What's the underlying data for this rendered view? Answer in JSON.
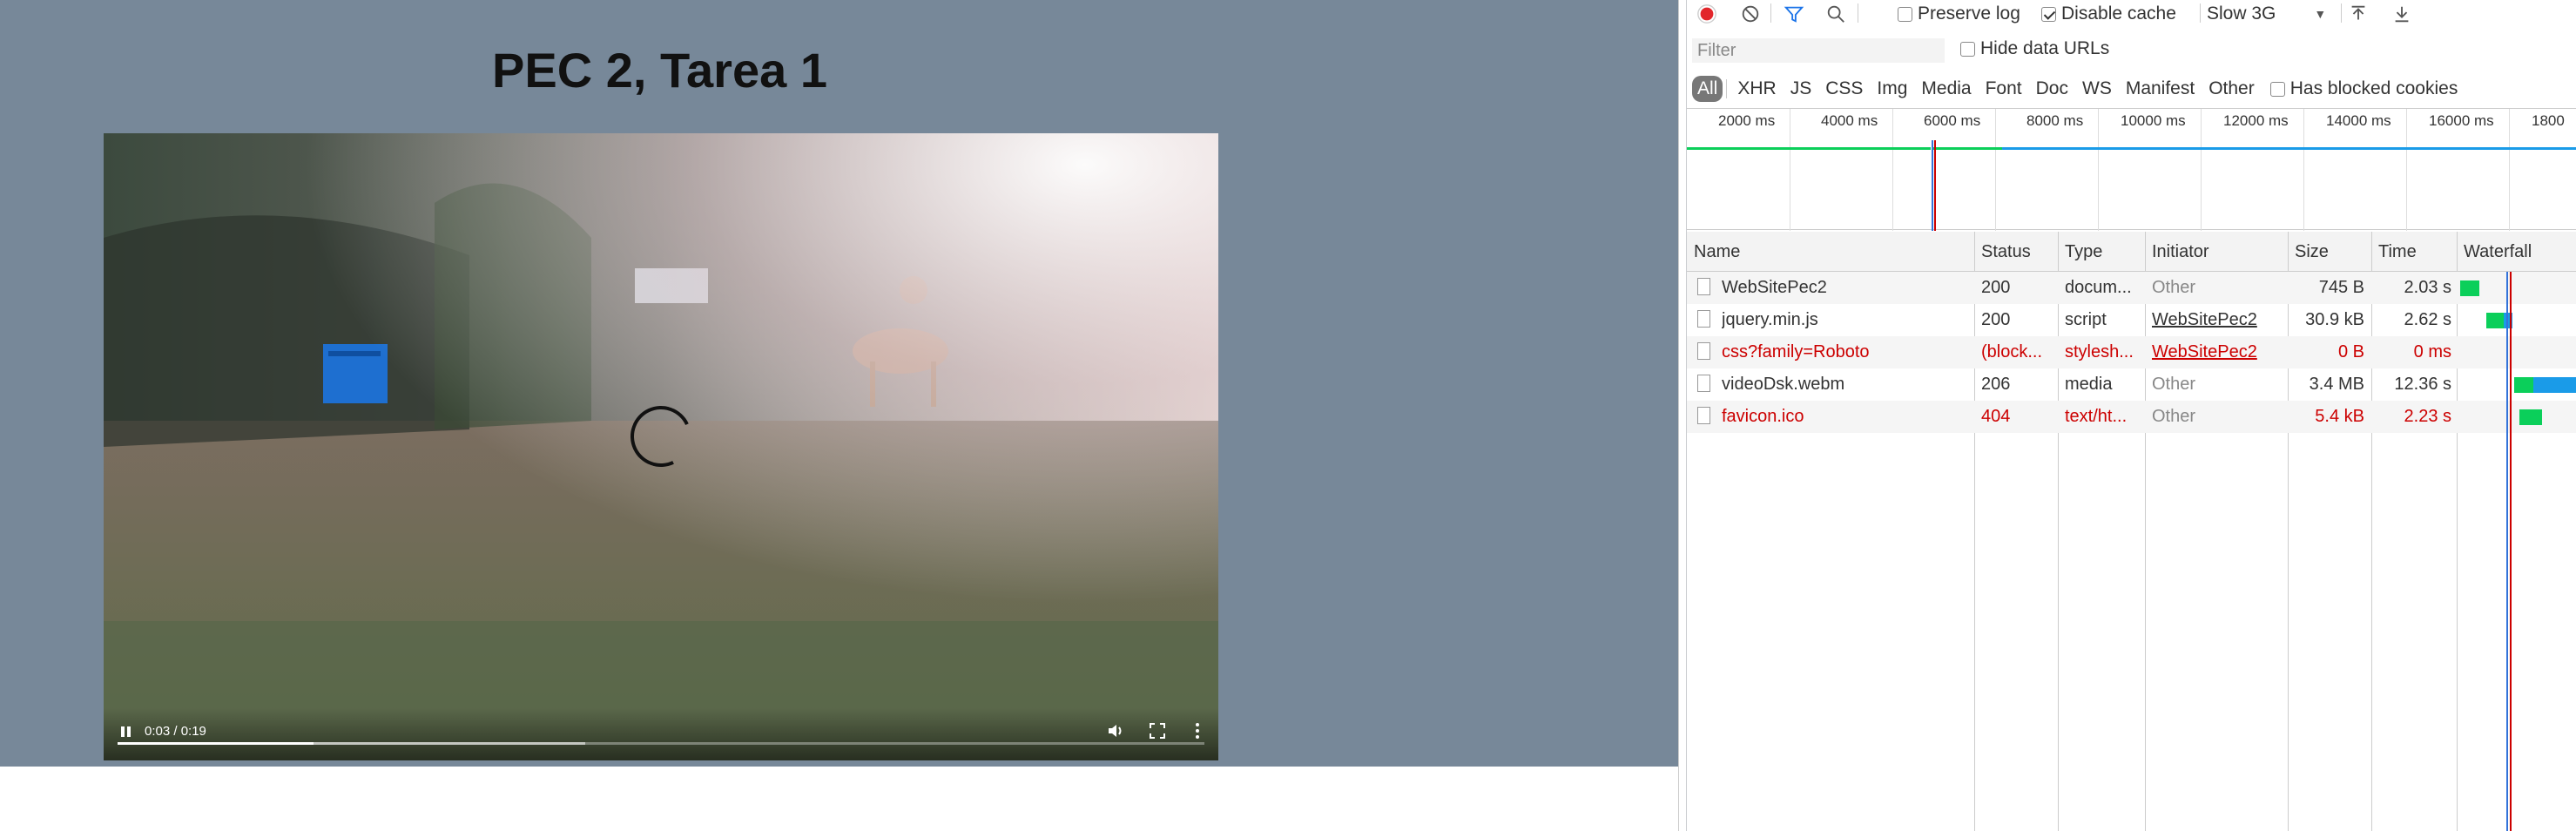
{
  "page": {
    "title": "PEC 2, Tarea 1"
  },
  "video": {
    "time": "0:03 / 0:19",
    "progress": 0.18,
    "buffered": 0.43
  },
  "devtools": {
    "toolbar": {
      "preserve_log": "Preserve log",
      "disable_cache": "Disable cache",
      "throttle": "Slow 3G",
      "preserve_log_checked": false,
      "disable_cache_checked": true
    },
    "filter": {
      "placeholder": "Filter",
      "hide_data_urls": "Hide data URLs"
    },
    "types": [
      "All",
      "XHR",
      "JS",
      "CSS",
      "Img",
      "Media",
      "Font",
      "Doc",
      "WS",
      "Manifest",
      "Other"
    ],
    "blocked_cookies": "Has blocked cookies",
    "timeline_ticks": [
      "2000 ms",
      "4000 ms",
      "6000 ms",
      "8000 ms",
      "10000 ms",
      "12000 ms",
      "14000 ms",
      "16000 ms",
      "1800"
    ],
    "columns": [
      "Name",
      "Status",
      "Type",
      "Initiator",
      "Size",
      "Time",
      "Waterfall"
    ],
    "requests": [
      {
        "name": "WebSitePec2",
        "status": "200",
        "type": "docum...",
        "initiator": "Other",
        "size": "745 B",
        "time": "2.03 s",
        "error": false,
        "init_link": false
      },
      {
        "name": "jquery.min.js",
        "status": "200",
        "type": "script",
        "initiator": "WebSitePec2",
        "size": "30.9 kB",
        "time": "2.62 s",
        "error": false,
        "init_link": true
      },
      {
        "name": "css?family=Roboto",
        "status": "(block...",
        "type": "stylesh...",
        "initiator": "WebSitePec2",
        "size": "0 B",
        "time": "0 ms",
        "error": true,
        "init_link": true
      },
      {
        "name": "videoDsk.webm",
        "status": "206",
        "type": "media",
        "initiator": "Other",
        "size": "3.4 MB",
        "time": "12.36 s",
        "error": false,
        "init_link": false
      },
      {
        "name": "favicon.ico",
        "status": "404",
        "type": "text/ht...",
        "initiator": "Other",
        "size": "5.4 kB",
        "time": "2.23 s",
        "error": true,
        "init_link": false
      }
    ]
  },
  "colors": {
    "page_bg": "#778899",
    "record": "#e2262b",
    "filter_active": "#1a73e8",
    "error": "#cc0000",
    "waterfall_green": "#0bcf5a",
    "waterfall_blue": "#1a9be8"
  }
}
